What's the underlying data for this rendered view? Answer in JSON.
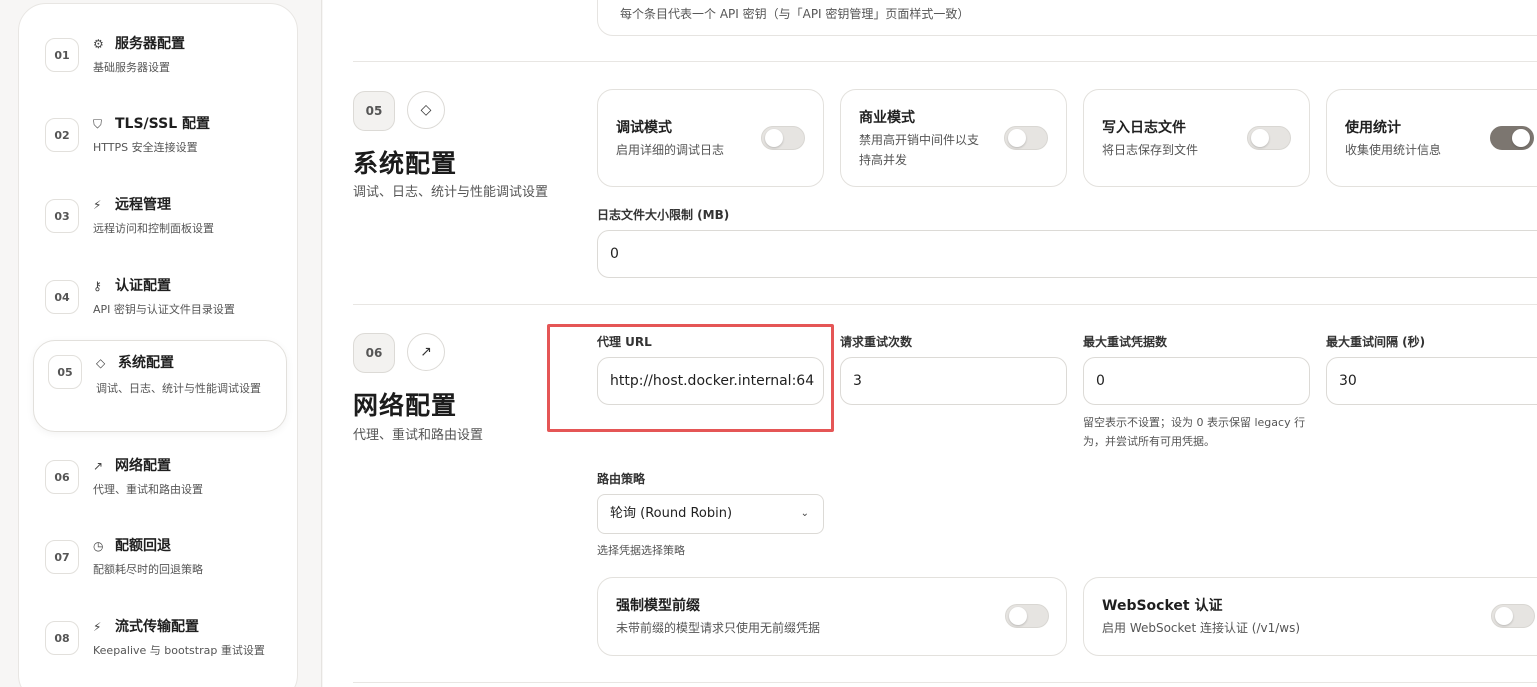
{
  "sidebar": {
    "items": [
      {
        "num": "01",
        "icon": "gear-icon",
        "glyph": "⚙",
        "title": "服务器配置",
        "desc": "基础服务器设置"
      },
      {
        "num": "02",
        "icon": "shield-icon",
        "glyph": "⛉",
        "title": "TLS/SSL 配置",
        "desc": "HTTPS 安全连接设置"
      },
      {
        "num": "03",
        "icon": "satellite-icon",
        "glyph": "⚡",
        "title": "远程管理",
        "desc": "远程访问和控制面板设置"
      },
      {
        "num": "04",
        "icon": "key-icon",
        "glyph": "⚷",
        "title": "认证配置",
        "desc": "API 密钥与认证文件目录设置"
      },
      {
        "num": "05",
        "icon": "diamond-icon",
        "glyph": "◇",
        "title": "系统配置",
        "desc": "调试、日志、统计与性能调试设置"
      },
      {
        "num": "06",
        "icon": "trend-up-icon",
        "glyph": "↗",
        "title": "网络配置",
        "desc": "代理、重试和路由设置"
      },
      {
        "num": "07",
        "icon": "timer-icon",
        "glyph": "◷",
        "title": "配额回退",
        "desc": "配额耗尽时的回退策略"
      },
      {
        "num": "08",
        "icon": "satellite-icon",
        "glyph": "⚡",
        "title": "流式传输配置",
        "desc": "Keepalive 与 bootstrap 重试设置"
      }
    ]
  },
  "main": {
    "prev_card_text": "每个条目代表一个 API 密钥（与「API 密钥管理」页面样式一致）",
    "system": {
      "num": "05",
      "icon_glyph": "◇",
      "title": "系统配置",
      "desc": "调试、日志、统计与性能调试设置",
      "toggles": [
        {
          "title": "调试模式",
          "desc": "启用详细的调试日志",
          "on": false
        },
        {
          "title": "商业模式",
          "desc": "禁用高开销中间件以支持高并发",
          "on": false
        },
        {
          "title": "写入日志文件",
          "desc": "将日志保存到文件",
          "on": false
        },
        {
          "title": "使用统计",
          "desc": "收集使用统计信息",
          "on": true
        }
      ],
      "log_size_label": "日志文件大小限制 (MB)",
      "log_size_value": "0"
    },
    "network": {
      "num": "06",
      "icon_glyph": "↗",
      "title": "网络配置",
      "desc": "代理、重试和路由设置",
      "proxy_label": "代理 URL",
      "proxy_value": "http://host.docker.internal:64",
      "retry_label": "请求重试次数",
      "retry_value": "3",
      "max_retry_cred_label": "最大重试凭据数",
      "max_retry_cred_value": "0",
      "max_retry_cred_hint": "留空表示不设置；设为 0 表示保留 legacy 行为，并尝试所有可用凭据。",
      "max_retry_interval_label": "最大重试间隔 (秒)",
      "max_retry_interval_value": "30",
      "routing_label": "路由策略",
      "routing_value": "轮询 (Round Robin)",
      "routing_hint": "选择凭据选择策略",
      "toggles": [
        {
          "title": "强制模型前缀",
          "desc": "未带前缀的模型请求只使用无前缀凭据",
          "on": false
        },
        {
          "title": "WebSocket 认证",
          "desc": "启用 WebSocket 连接认证 (/v1/ws)",
          "on": false
        }
      ]
    }
  },
  "colors": {
    "highlight": "#e55656",
    "switch_on": "#7c7670"
  }
}
